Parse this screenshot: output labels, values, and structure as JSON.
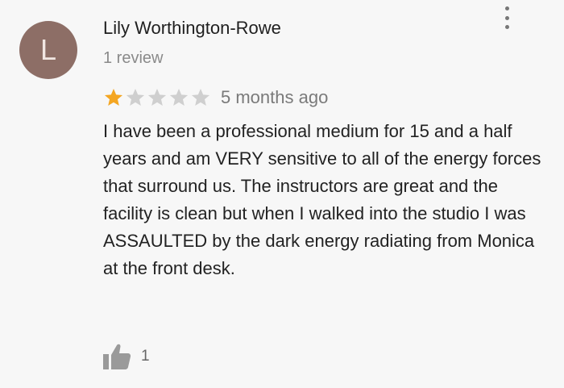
{
  "review": {
    "avatar_letter": "L",
    "author_name": "Lily Worthington-Rowe",
    "review_count": "1 review",
    "rating": 1,
    "rating_max": 5,
    "time_ago": "5 months ago",
    "text": "I have been a professional medium for 15 and a half years and am VERY sensitive to all of the energy forces that surround us. The instructors are great and the facility is clean but when I walked into the studio I was ASSAULTED by the dark energy radiating from Monica at the front desk.",
    "like_count": "1"
  },
  "icons": {
    "menu": "more-vert-icon",
    "like": "thumb-up-icon",
    "star": "star-icon"
  },
  "colors": {
    "background": "#f7f7f7",
    "avatar": "#8d6e66",
    "star_filled": "#f4a622",
    "star_empty": "#cfcfcf",
    "secondary_text": "#8a8a8a"
  }
}
